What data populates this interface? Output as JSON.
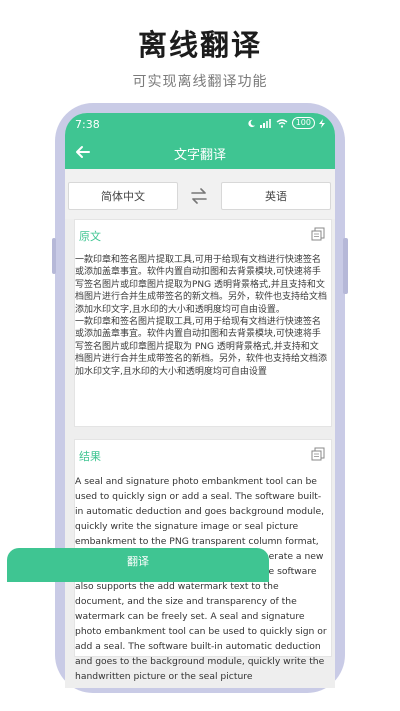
{
  "promo": {
    "headline": "离线翻译",
    "subline": "可实现离线翻译功能"
  },
  "status_bar": {
    "time": "7:38",
    "icons": [
      "moon-icon",
      "signal-icon",
      "wifi-icon",
      "battery-icon",
      "charging-icon"
    ],
    "battery_label": "100"
  },
  "app_bar": {
    "title": "文字翻译",
    "back_icon": "arrow-left-icon"
  },
  "languages": {
    "source": "简体中文",
    "target": "英语",
    "swap_icon": "swap-arrows-icon"
  },
  "source_card": {
    "title": "原文",
    "copy_icon": "copy-icon",
    "text": "一款印章和签名图片提取工具,可用于给现有文档进行快速签名或添加盖章事宜。软件内置自动扣图和去背景模块,可快速将手写签名图片或印章图片提取为PNG 透明背景格式,并且支持和文档图片进行合并生成带签名的新文档。另外，软件也支持给文档添加水印文字,且水印的大小和透明度均可自由设置。\n一款印章和签名图片提取工具,可用于给现有文档进行快速签名或添加盖章事宜。软件内置自动扣图和去背景模块,可快速将手写签名图片或印章图片提取为 PNG 透明背景格式,并支持和文档图片进行合并生成带签名的新档。另外，软件也支持给文档添加水印文字,且水印的大小和透明度均可自由设置"
  },
  "result_card": {
    "title": "结果",
    "copy_icon": "copy-icon",
    "text": "A seal and signature photo embankment tool can be used to quickly sign or add a seal. The software built-in automatic deduction and goes background module, quickly write the signature image or seal picture embankment to the PNG transparent column format, and support and document images to generate a new document with a signature. In addition, the software also supports the add watermark text to the document, and the size and transparency of the watermark can be freely set. A seal and signature photo embankment tool can be used to quickly sign or add a seal. The software built-in automatic deduction and goes to the background module, quickly write the handwritten picture or the seal picture"
  },
  "translate_button": {
    "label": "翻译"
  },
  "colors": {
    "accent": "#3fc592",
    "phone_frame": "#c9cbe6",
    "screen_bg": "#eeeeee"
  }
}
